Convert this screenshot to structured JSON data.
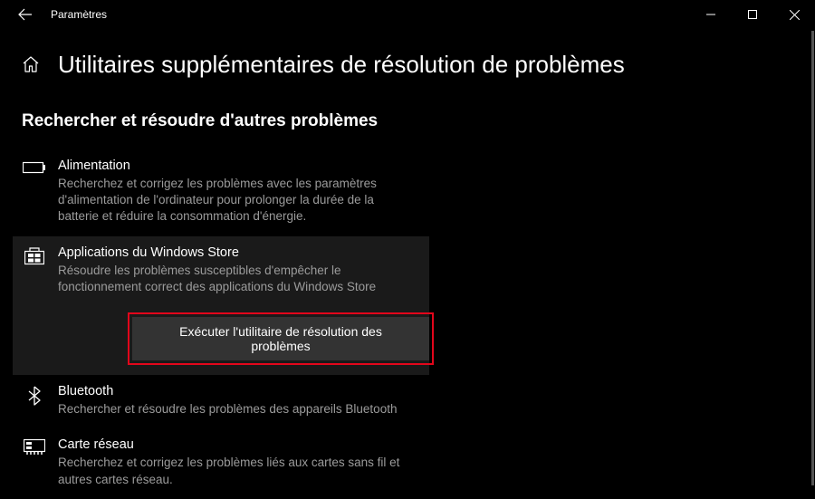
{
  "window": {
    "title": "Paramètres"
  },
  "page": {
    "heading": "Utilitaires supplémentaires de résolution de problèmes",
    "section_header": "Rechercher et résoudre d'autres problèmes"
  },
  "troubleshooters": [
    {
      "icon": "battery-icon",
      "title": "Alimentation",
      "desc": "Recherchez et corrigez les problèmes avec les paramètres d'alimentation de l'ordinateur pour prolonger la durée de la batterie et réduire la consommation d'énergie.",
      "selected": false
    },
    {
      "icon": "windows-store-icon",
      "title": "Applications du Windows Store",
      "desc": "Résoudre les problèmes susceptibles d'empêcher le fonctionnement correct des applications du Windows Store",
      "selected": true,
      "action_label": "Exécuter l'utilitaire de résolution des problèmes"
    },
    {
      "icon": "bluetooth-icon",
      "title": "Bluetooth",
      "desc": "Rechercher et résoudre les problèmes des appareils Bluetooth",
      "selected": false
    },
    {
      "icon": "network-card-icon",
      "title": "Carte réseau",
      "desc": "Recherchez et corrigez les problèmes liés aux cartes sans fil et autres cartes réseau.",
      "selected": false
    }
  ]
}
